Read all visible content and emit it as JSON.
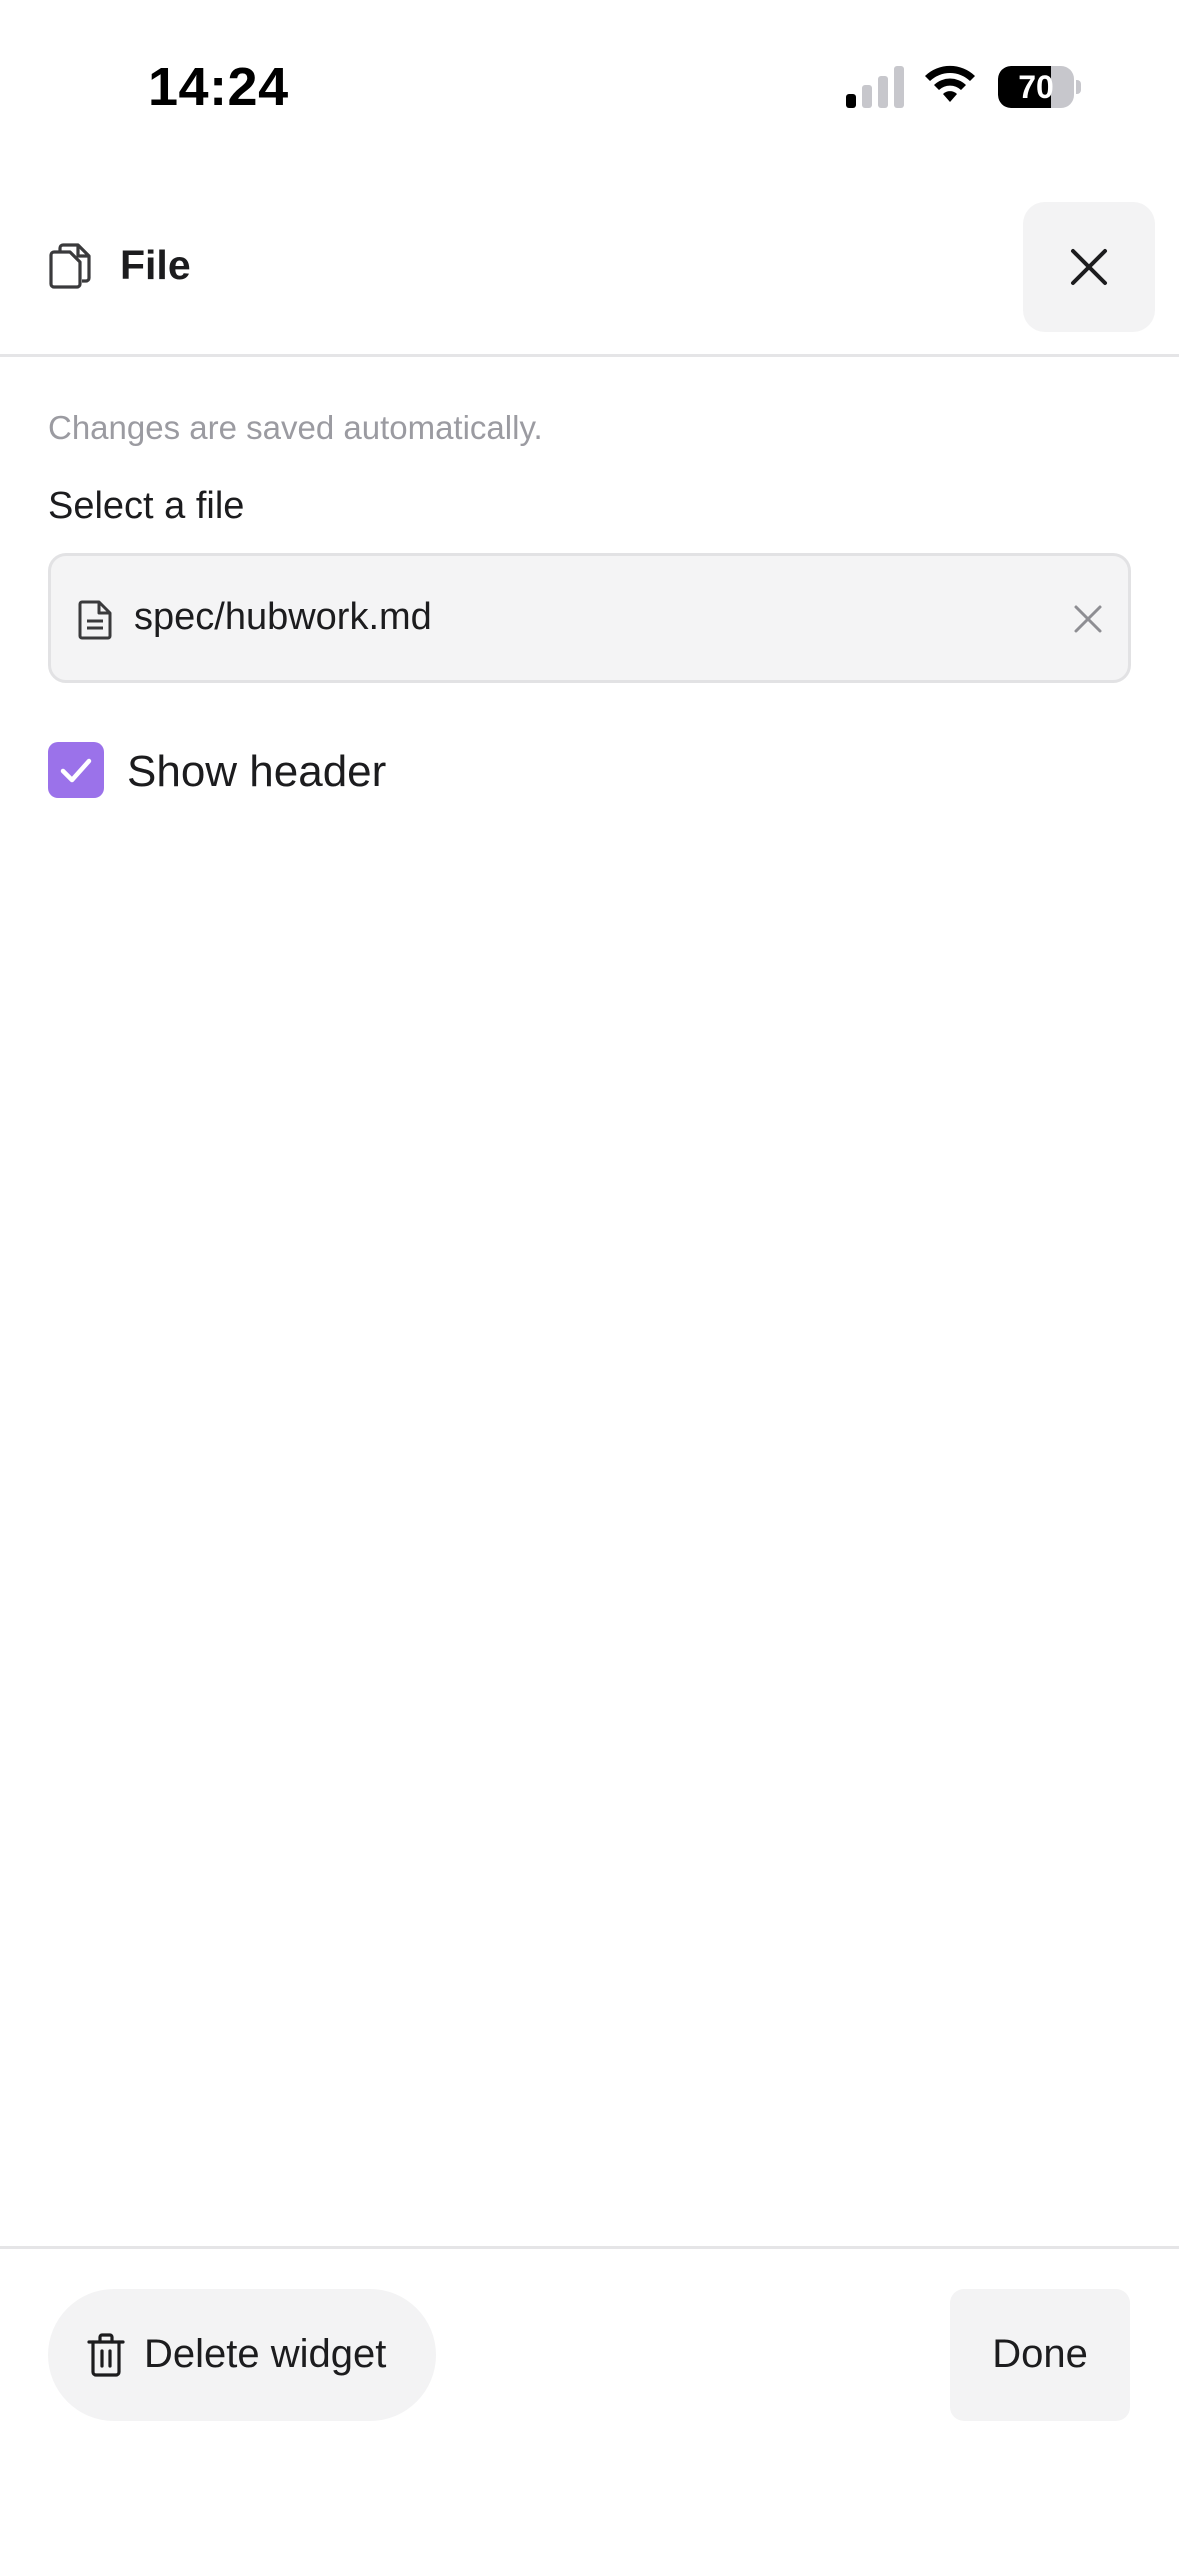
{
  "status_bar": {
    "time": "14:24",
    "battery_level": "70",
    "battery_fraction": 0.7,
    "signal_icon": "cellular-signal-icon",
    "wifi_icon": "wifi-icon"
  },
  "header": {
    "icon": "file-copy-icon",
    "title": "File",
    "close_icon": "close-icon"
  },
  "form": {
    "hint": "Changes are saved automatically.",
    "select_label": "Select a file",
    "file_icon": "document-icon",
    "selected_file": "spec/hubwork.md",
    "clear_icon": "clear-icon",
    "show_header_label": "Show header",
    "show_header_checked": true
  },
  "footer": {
    "delete_icon": "trash-icon",
    "delete_label": "Delete widget",
    "done_label": "Done"
  },
  "colors": {
    "accent": "#9b72ea",
    "button_bg": "#f3f3f4",
    "hint_text": "#9b9ba1",
    "divider": "#e5e5e7"
  }
}
